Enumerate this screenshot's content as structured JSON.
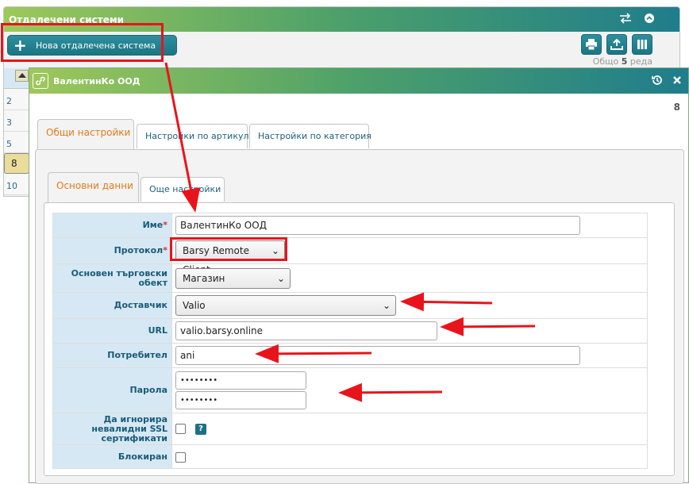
{
  "background": {
    "title": "Отдалечени системи",
    "new_button_label": "Нова отдалечена система",
    "total_prefix": "Общо",
    "total_count": "5",
    "total_suffix": "реда",
    "rows": [
      "2",
      "3",
      "5",
      "8",
      "10"
    ]
  },
  "dialog": {
    "title": "ВалентинКо ООД",
    "record_number": "8",
    "tabs": [
      "Общи настройки",
      "Настройки по артикул",
      "Настройки по категория"
    ],
    "subtabs": [
      "Основни данни",
      "Още настройки"
    ],
    "fields": {
      "name_label": "Име",
      "name_value": "ВалентинКо ООД",
      "protocol_label": "Протокол",
      "protocol_value": "Barsy Remote Client",
      "store_label": "Основен търговски обект",
      "store_value": "Магазин",
      "supplier_label": "Доставчик",
      "supplier_value": "Valio",
      "url_label": "URL",
      "url_value": "valio.barsy.online",
      "user_label": "Потребител",
      "user_value": "ani",
      "password_label": "Парола",
      "password_value": "••••••••",
      "password_repeat_value": "••••••••",
      "ssl_label": "Да игнорира невалидни SSL сертификати",
      "blocked_label": "Блокиран",
      "required_mark": "*",
      "help_mark": "?"
    }
  },
  "colors": {
    "header_gradient_start": "#9ec85a",
    "header_gradient_end": "#1f7d8c",
    "button": "#1f7d8c",
    "label_bg": "#d6e8f3",
    "active_tab_text": "#e07b1a",
    "annotation_red": "#e8141b"
  }
}
